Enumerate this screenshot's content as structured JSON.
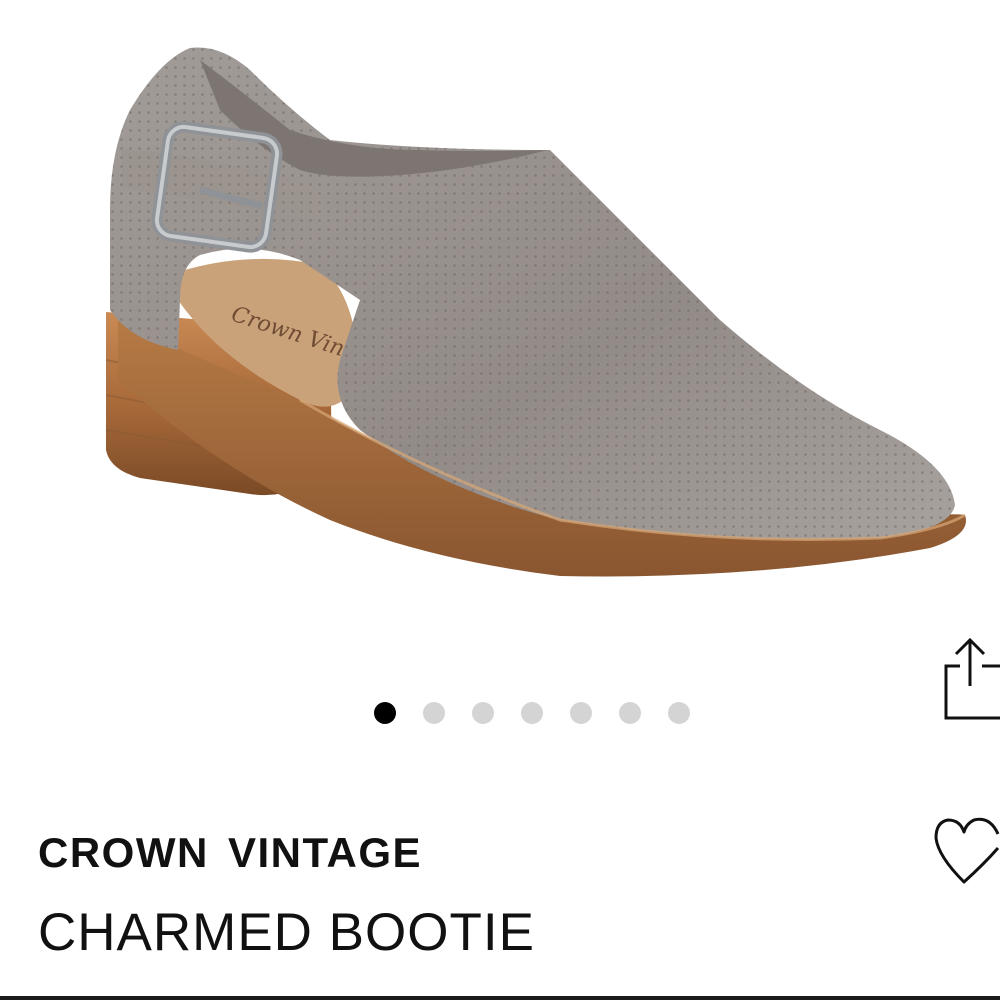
{
  "product": {
    "brand": "CROWN VINTAGE",
    "name": "CHARMED BOOTIE",
    "image_label": "Crown Vintage"
  },
  "carousel": {
    "total": 7,
    "active_index": 0
  },
  "icons": {
    "share": "share-icon",
    "favorite": "heart-icon"
  },
  "colors": {
    "active_dot": "#000000",
    "inactive_dot": "#d4d4d4",
    "text": "#111111"
  }
}
